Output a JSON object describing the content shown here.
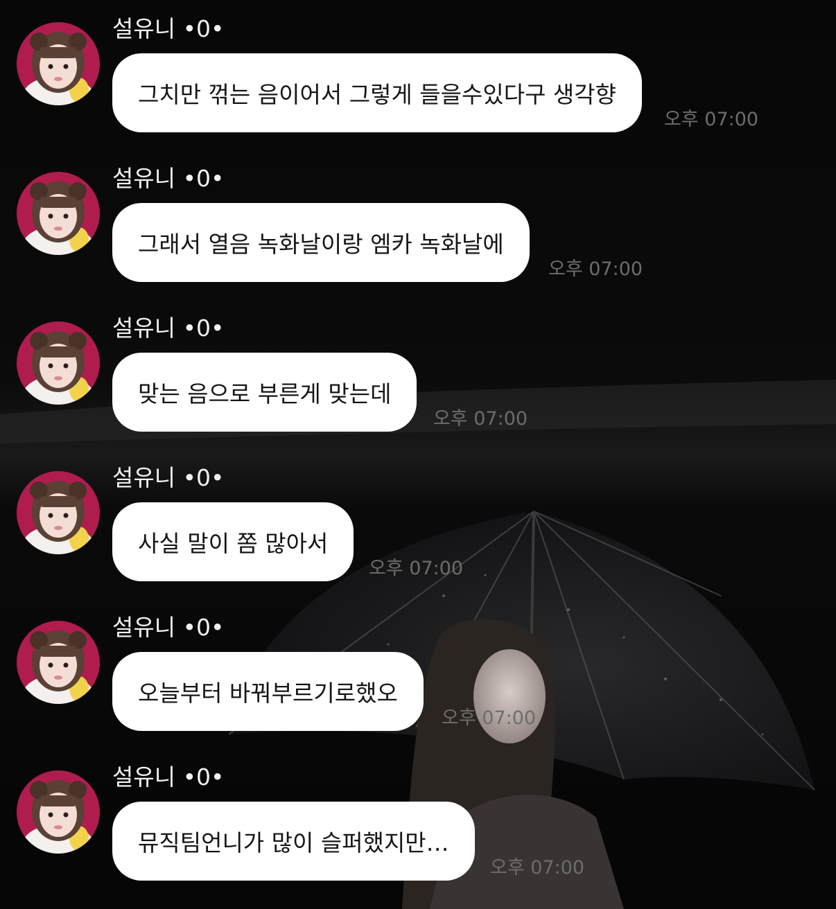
{
  "messages": [
    {
      "sender": "설유니 •0•",
      "text": "그치만 꺾는 음이어서 그렇게 들을수있다구 생각향",
      "time": "오후 07:00"
    },
    {
      "sender": "설유니 •0•",
      "text": "그래서 열음 녹화날이랑 엠카 녹화날에",
      "time": "오후 07:00"
    },
    {
      "sender": "설유니 •0•",
      "text": "맞는 음으로 부른게 맞는데",
      "time": "오후 07:00"
    },
    {
      "sender": "설유니 •0•",
      "text": "사실 말이 쫌 많아서",
      "time": "오후 07:00"
    },
    {
      "sender": "설유니 •0•",
      "text": "오늘부터 바꿔부르기로했오",
      "time": "오후 07:00"
    },
    {
      "sender": "설유니 •0•",
      "text": "뮤직팀언니가 많이 슬퍼했지만…",
      "time": "오후 07:00"
    }
  ],
  "colors": {
    "background": "#050505",
    "bubble": "#ffffff",
    "bubble_text": "#151515",
    "sender_text": "#f2f2f2",
    "time_text": "#6d6d6d",
    "avatar_bg": "#b01c4e"
  },
  "icons": {
    "avatar": "profile-photo",
    "background": "umbrella-wallpaper"
  }
}
